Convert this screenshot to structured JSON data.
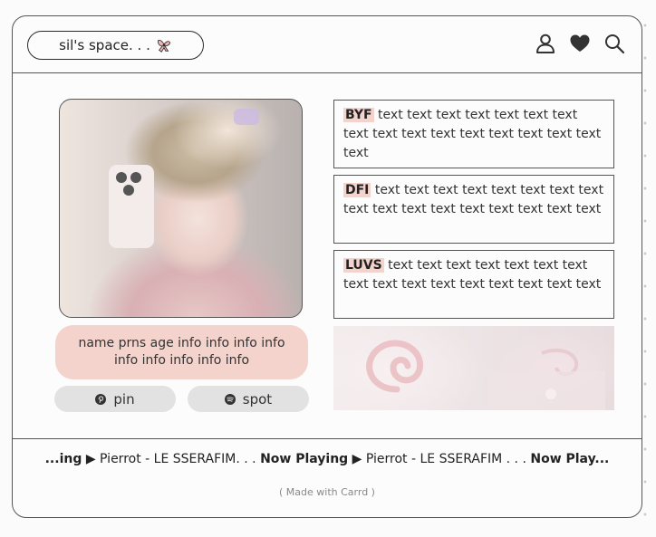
{
  "header": {
    "brand_text": "sil's space. . .",
    "brand_deco_icon": "pink-bow-icon",
    "icons": [
      "user-icon",
      "heart-icon",
      "search-icon"
    ]
  },
  "profile": {
    "info": "name prns age info info info info info info info info info",
    "buttons": [
      {
        "label": "pin",
        "icon": "pinterest-icon"
      },
      {
        "label": "spot",
        "icon": "spotify-icon"
      }
    ]
  },
  "text_boxes": [
    {
      "tag": "BYF",
      "body": " text text text text text text text text text text text text text text text text text"
    },
    {
      "tag": "DFI",
      "body": " text text text text text text text text text text text text text text text text text"
    },
    {
      "tag": "LUVS",
      "body": " text text text text text text text text text text text text text text text text"
    }
  ],
  "now_playing": {
    "lead": "...ing",
    "track1": " Pierrot - LE SSERAFIM. . . ",
    "label": "Now Playing",
    "track2": " Pierrot - LE SSERAFIM . . . ",
    "tail": "Now Play..."
  },
  "footer": {
    "made_with": "( Made with Carrd )"
  },
  "colors": {
    "accent_pink": "#f4d3cc",
    "button_gray": "#e2e2e2",
    "border": "#555555"
  }
}
